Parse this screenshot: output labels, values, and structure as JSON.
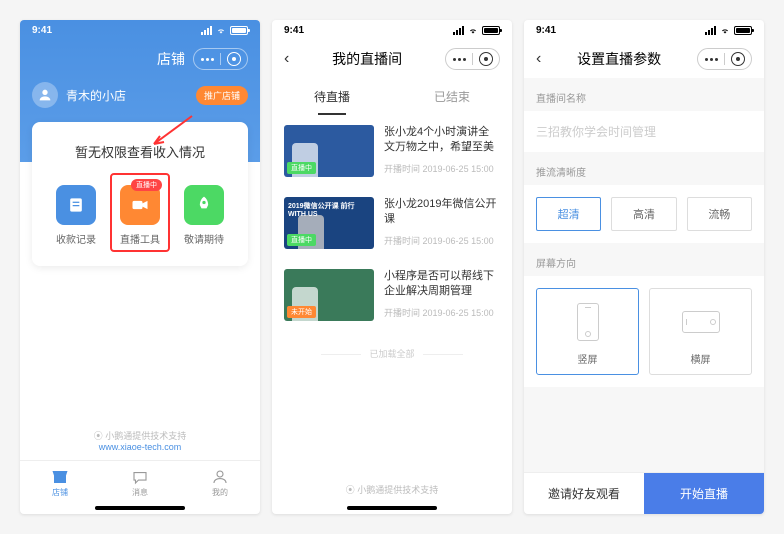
{
  "status": {
    "time": "9:41"
  },
  "phone1": {
    "header_title": "店铺",
    "shop_name": "青木的小店",
    "promo_badge": "推广店铺",
    "card_title": "暂无权限查看收入情况",
    "tools": [
      {
        "label": "收款记录"
      },
      {
        "label": "直播工具",
        "badge": "直播中"
      },
      {
        "label": "敬请期待"
      }
    ],
    "footer_provider": "小鹅通提供技术支持",
    "footer_url": "www.xiaoe-tech.com",
    "tabs": [
      {
        "label": "店铺"
      },
      {
        "label": "消息"
      },
      {
        "label": "我的"
      }
    ]
  },
  "phone2": {
    "title": "我的直播间",
    "tabs": {
      "pending": "待直播",
      "ended": "已结束"
    },
    "items": [
      {
        "title": "张小龙4个小时演讲全文万物之中，希望至美",
        "time_label": "开播时间",
        "time": "2019-06-25 15:00",
        "badge": "直播中",
        "thumb_text": ""
      },
      {
        "title": "张小龙2019年微信公开课",
        "time_label": "开播时间",
        "time": "2019-06-25 15:00",
        "badge": "直播中",
        "thumb_text": "2019微信公开课\n前行 WITH US"
      },
      {
        "title": "小程序是否可以帮线下企业解决周期管理",
        "time_label": "开播时间",
        "time": "2019-06-25 15:00",
        "badge": "未开始",
        "thumb_text": ""
      }
    ],
    "loaded_all": "已加载全部",
    "footer": "小鹅通提供技术支持"
  },
  "phone3": {
    "title": "设置直播参数",
    "room_name_label": "直播间名称",
    "room_name_placeholder": "三招教你学会时间管理",
    "quality_label": "推流清晰度",
    "quality_options": [
      "超清",
      "高清",
      "流畅"
    ],
    "orientation_label": "屏幕方向",
    "orientation_options": {
      "portrait": "竖屏",
      "landscape": "横屏"
    },
    "invite_btn": "邀请好友观看",
    "start_btn": "开始直播"
  }
}
